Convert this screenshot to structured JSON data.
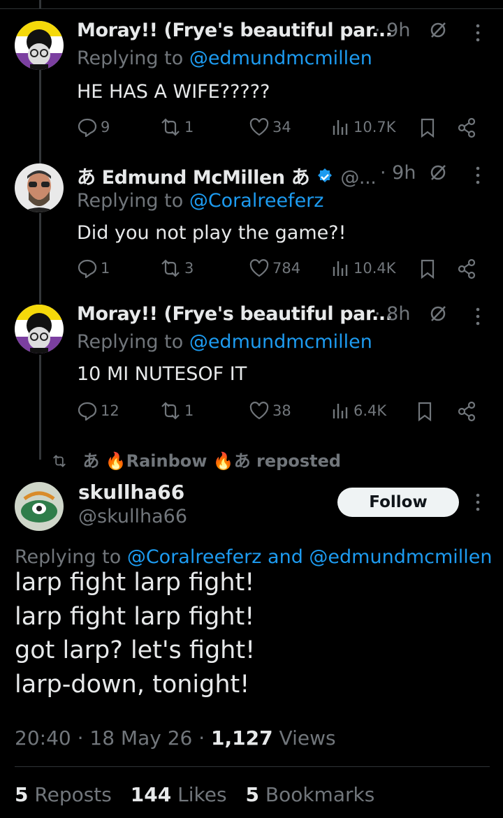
{
  "tweets": [
    {
      "name": "Moray!! (Frye's beautiful par...",
      "time": "· 9h",
      "reply_prefix": "Replying to",
      "reply_handle": "@edmundmcmillen",
      "text": "HE HAS A WIFE?????",
      "replies": "9",
      "reposts": "1",
      "likes": "34",
      "views": "10.7K"
    },
    {
      "name": "あ Edmund McMillen あ",
      "handle_short": "@...",
      "time": "· 9h",
      "reply_prefix": "Replying to",
      "reply_handle": "@Coralreeferz",
      "text": "Did you not play the game?!",
      "replies": "1",
      "reposts": "3",
      "likes": "784",
      "views": "10.4K"
    },
    {
      "name": "Moray!! (Frye's beautiful par...",
      "time": "· 8h",
      "reply_prefix": "Replying to",
      "reply_handle": "@edmundmcmillen",
      "text": "10 MI NUTESOF IT",
      "replies": "12",
      "reposts": "1",
      "likes": "38",
      "views": "6.4K"
    }
  ],
  "repost_banner": {
    "prefix": "あ",
    "name": "Rainbow",
    "suffix": "あ reposted"
  },
  "main": {
    "name": "skullha66",
    "handle": "@skullha66",
    "follow_label": "Follow",
    "reply_prefix": "Replying to",
    "reply_handles": "@Coralreeferz and @edmundmcmillen",
    "lines": [
      "larp fight larp fight!",
      "larp fight larp fight!",
      "got larp? let's fight!",
      "larp-down, tonight!"
    ],
    "time": "20:40 · 18 May 26 ·",
    "views_count": "1,127",
    "views_label": "Views",
    "reposts_count": "5",
    "reposts_label": "Reposts",
    "likes_count": "144",
    "likes_label": "Likes",
    "bookmarks_count": "5",
    "bookmarks_label": "Bookmarks"
  },
  "colors": {
    "link": "#1d9bf0",
    "muted": "#71767b",
    "text": "#e7e9ea",
    "verified": "#1d9bf0"
  }
}
